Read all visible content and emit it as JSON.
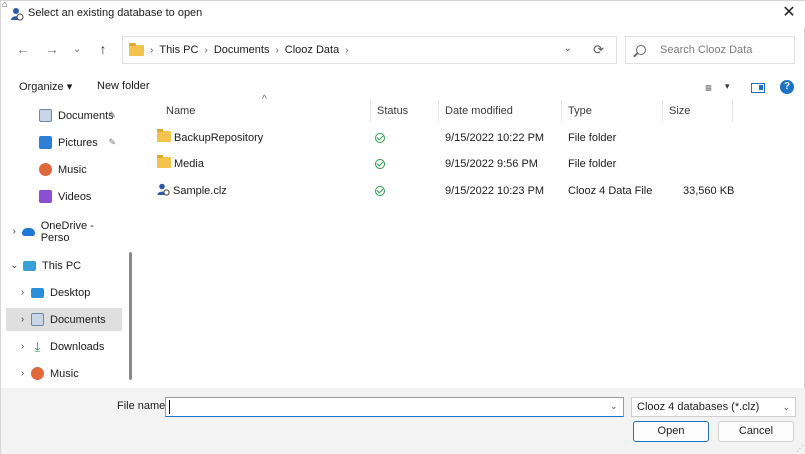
{
  "window": {
    "title": "Select an existing database to open",
    "close_glyph": "✕"
  },
  "nav": {
    "back_glyph": "←",
    "forward_glyph": "→",
    "recent_glyph": "⌄",
    "up_glyph": "↑",
    "breadcrumbs": [
      "This PC",
      "Documents",
      "Clooz Data"
    ],
    "crumb_sep": "›",
    "address_dropdown_glyph": "⌄",
    "refresh_glyph": "⟳",
    "search_placeholder": "Search Clooz Data"
  },
  "toolbar": {
    "organize_label": "Organize ▾",
    "new_folder_label": "New folder",
    "view_glyph": "≡",
    "view_dropdown_glyph": "▾",
    "help_glyph": "?"
  },
  "nav_pane": {
    "items": [
      {
        "label": "Documents",
        "icon": "documents-icon",
        "pinned": true,
        "chevron": ""
      },
      {
        "label": "Pictures",
        "icon": "pictures-icon",
        "pinned": true,
        "chevron": ""
      },
      {
        "label": "Music",
        "icon": "music-icon",
        "pinned": false,
        "chevron": ""
      },
      {
        "label": "Videos",
        "icon": "videos-icon",
        "pinned": false,
        "chevron": ""
      },
      {
        "label": "OneDrive - Perso",
        "icon": "onedrive-icon",
        "pinned": false,
        "chevron": "›"
      },
      {
        "label": "This PC",
        "icon": "this-pc-icon",
        "pinned": false,
        "chevron": "⌄"
      },
      {
        "label": "Desktop",
        "icon": "desktop-icon",
        "pinned": false,
        "chevron": "›"
      },
      {
        "label": "Documents",
        "icon": "documents-icon",
        "pinned": false,
        "chevron": "›",
        "selected": true
      },
      {
        "label": "Downloads",
        "icon": "downloads-icon",
        "pinned": false,
        "chevron": "›"
      },
      {
        "label": "Music",
        "icon": "music-icon",
        "pinned": false,
        "chevron": "›"
      }
    ],
    "pin_glyph": "📌"
  },
  "file_list": {
    "columns": {
      "name": "Name",
      "status": "Status",
      "date": "Date modified",
      "type": "Type",
      "size": "Size"
    },
    "sort_glyph": "^",
    "rows": [
      {
        "name": "BackupRepository",
        "kind": "folder",
        "date": "9/15/2022 10:22 PM",
        "type": "File folder",
        "size": ""
      },
      {
        "name": "Media",
        "kind": "folder",
        "date": "9/15/2022 9:56 PM",
        "type": "File folder",
        "size": ""
      },
      {
        "name": "Sample.clz",
        "kind": "database",
        "date": "9/15/2022 10:23 PM",
        "type": "Clooz 4 Data File",
        "size": "33,560 KB"
      }
    ]
  },
  "footer": {
    "file_name_label": "File name:",
    "file_name_value": "",
    "file_name_dropdown_glyph": "⌄",
    "filter_value": "Clooz 4 databases (*.clz)",
    "filter_dropdown_glyph": "⌄",
    "open_label": "Open",
    "cancel_label": "Cancel"
  },
  "colors": {
    "accent": "#1a73c9",
    "status_ok": "#2e9e4c",
    "folder": "#f3c34b",
    "selection": "#dfdfdf"
  }
}
